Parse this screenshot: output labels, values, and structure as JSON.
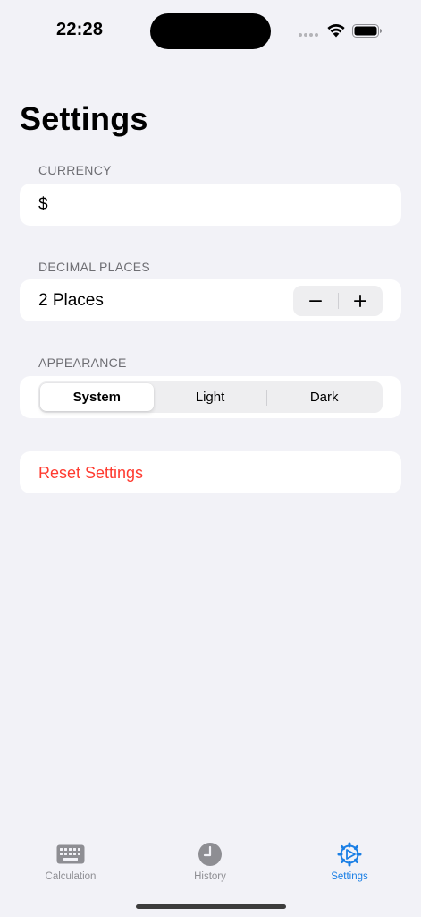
{
  "status_bar": {
    "time": "22:28"
  },
  "page": {
    "title": "Settings"
  },
  "currency": {
    "header": "CURRENCY",
    "value": "$"
  },
  "decimal_places": {
    "header": "DECIMAL PLACES",
    "value": "2 Places",
    "decrement": "−",
    "increment": "+"
  },
  "appearance": {
    "header": "APPEARANCE",
    "options": [
      "System",
      "Light",
      "Dark"
    ],
    "selected": "System"
  },
  "reset": {
    "label": "Reset Settings"
  },
  "tabs": [
    {
      "label": "Calculation",
      "icon": "keyboard-icon"
    },
    {
      "label": "History",
      "icon": "clock-icon"
    },
    {
      "label": "Settings",
      "icon": "gear-icon"
    }
  ],
  "colors": {
    "accent": "#1a7fe5",
    "destructive": "#ff3b30",
    "background": "#f2f2f7"
  }
}
